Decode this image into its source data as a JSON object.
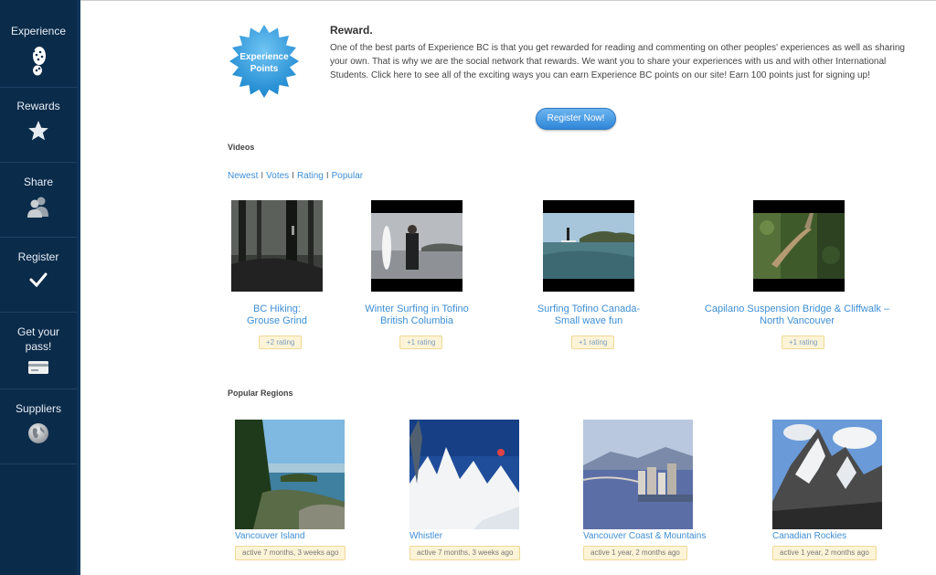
{
  "sidebar": {
    "items": [
      {
        "label": "Experience",
        "icon": "footprint-icon"
      },
      {
        "label": "Rewards",
        "icon": "star-icon"
      },
      {
        "label": "Share",
        "icon": "people-icon"
      },
      {
        "label": "Register",
        "icon": "checkmark-icon"
      },
      {
        "label": "Get your pass!",
        "icon": "card-icon"
      },
      {
        "label": "Suppliers",
        "icon": "globe-icon"
      }
    ]
  },
  "reward": {
    "badge_line1": "Experience",
    "badge_line2": "Points",
    "title": "Reward.",
    "body": "One of the best parts of Experience BC is that you get rewarded for reading and commenting on other peoples' experiences as well as sharing your own. That is why we are the social network that rewards. We want you to share your experiences with us and with other International Students. Click here to see all of the exciting ways you can earn Experience BC points on our site! Earn 100 points just for signing up!",
    "register_label": "Register Now!"
  },
  "videos": {
    "title": "Videos",
    "filters": [
      "Newest",
      "Votes",
      "Rating",
      "Popular"
    ],
    "items": [
      {
        "title_line1": "BC Hiking:",
        "title_line2": "Grouse Grind",
        "rating": "+2 rating"
      },
      {
        "title_line1": "Winter Surfing in Tofino",
        "title_line2": "British Columbia",
        "rating": "+1 rating"
      },
      {
        "title_line1": "Surfing Tofino Canada-",
        "title_line2": "Small wave fun",
        "rating": "+1 rating"
      },
      {
        "title_line1": "Capilano Suspension Bridge & Cliffwalk –",
        "title_line2": "North Vancouver",
        "rating": "+1 rating"
      }
    ]
  },
  "regions": {
    "title": "Popular Regions",
    "items": [
      {
        "name": "Vancouver Island",
        "active": "active 7 months, 3 weeks ago"
      },
      {
        "name": "Whistler",
        "active": "active 7 months, 3 weeks ago"
      },
      {
        "name": "Vancouver Coast & Mountains",
        "active": "active 1 year, 2 months ago"
      },
      {
        "name": "Canadian Rockies",
        "active": "active 1 year, 2 months ago"
      }
    ]
  },
  "colors": {
    "sidebar": "#0b2b4a",
    "link": "#3d8fd6",
    "badge": "#2f9fe0"
  }
}
